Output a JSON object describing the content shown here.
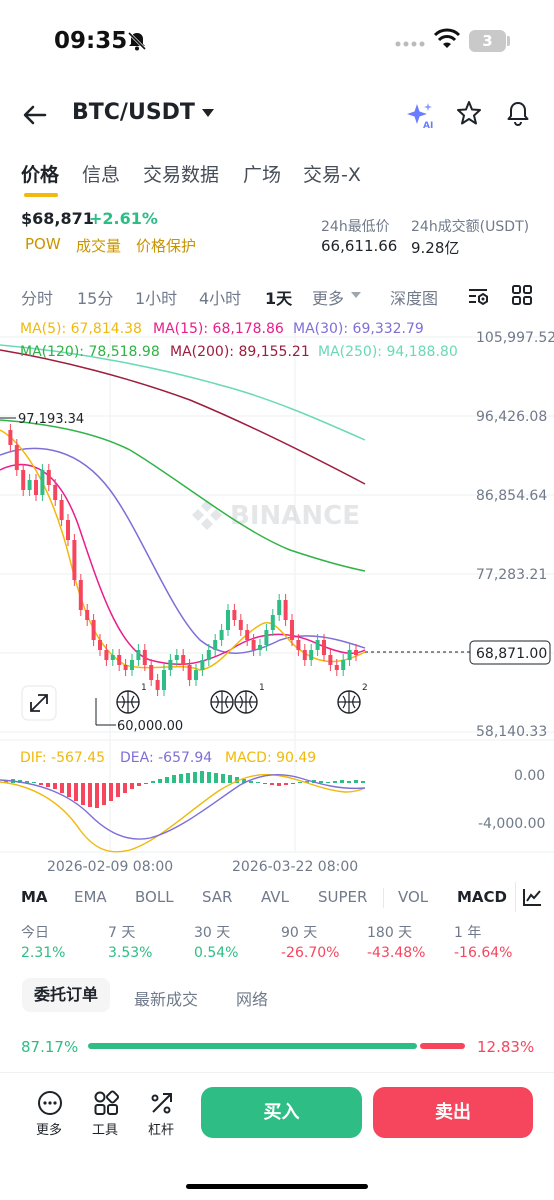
{
  "status_bar": {
    "time": "09:35",
    "battery": "3"
  },
  "header": {
    "pair": "BTC/USDT"
  },
  "tabs": [
    "价格",
    "信息",
    "交易数据",
    "广场",
    "交易-X"
  ],
  "price_info": {
    "last_price": "$68,871",
    "change": "+2.61%",
    "tags": [
      "POW",
      "成交量",
      "价格保护"
    ],
    "low_label": "24h最低价",
    "low_value": "66,611.66",
    "volume_label": "24h成交额(USDT)",
    "volume_value": "9.28亿"
  },
  "intervals": [
    "分时",
    "15分",
    "1小时",
    "4小时",
    "1天",
    "更多",
    "深度图"
  ],
  "ma_legend": {
    "ma5": "MA(5): 67,814.38",
    "ma15": "MA(15): 68,178.86",
    "ma30": "MA(30): 69,332.79",
    "ma120": "MA(120): 78,518.98",
    "ma200": "MA(200): 89,155.21",
    "ma250": "MA(250): 94,188.80"
  },
  "macd_legend": {
    "dif": "DIF: -567.45",
    "dea": "DEA: -657.94",
    "macd": "MACD: 90.49"
  },
  "watermark": "BINANCE",
  "chart_data": {
    "type": "candlestick",
    "y_ticks": [
      "105,997.52",
      "96,426.08",
      "86,854.64",
      "77,283.21",
      "58,140.33"
    ],
    "current_price_label": "68,871.00",
    "high_marker": "97,193.34",
    "low_marker": "60,000.00",
    "macd_ticks": [
      "0.00",
      "-4,000.00"
    ],
    "x_ticks": [
      "2026-02-09 08:00",
      "2026-03-22 08:00"
    ],
    "event_badges": [
      "1",
      "1",
      "2"
    ],
    "colors": {
      "up": "#2ebd85",
      "down": "#f6465d",
      "ma5": "#f0b90b",
      "ma15": "#e91e8c",
      "ma30": "#7e6fd6",
      "ma120": "#2fb344",
      "ma200": "#9e1c3c",
      "ma250": "#6ad9b8"
    }
  },
  "indicators": [
    "MA",
    "EMA",
    "BOLL",
    "SAR",
    "AVL",
    "SUPER",
    "VOL",
    "MACD"
  ],
  "performance": {
    "labels": [
      "今日",
      "7 天",
      "30 天",
      "90 天",
      "180 天",
      "1 年"
    ],
    "values": [
      "2.31%",
      "3.53%",
      "0.54%",
      "-26.70%",
      "-43.48%",
      "-16.64%"
    ]
  },
  "orderbook": {
    "tabs": [
      "委托订单",
      "最新成交",
      "网络"
    ],
    "buy_ratio": "87.17%",
    "sell_ratio": "12.83%",
    "buy_fraction": 0.8717
  },
  "bottom": {
    "more": "更多",
    "tools": "工具",
    "leverage": "杠杆",
    "buy": "买入",
    "sell": "卖出"
  }
}
